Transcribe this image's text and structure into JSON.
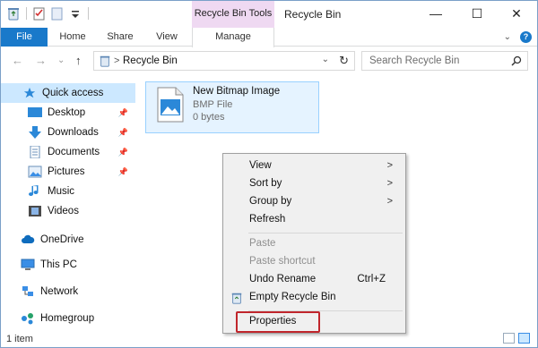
{
  "window": {
    "title": "Recycle Bin",
    "contextual_tab_group": "Recycle Bin Tools",
    "controls": {
      "minimize": "—",
      "maximize": "☐",
      "close": "✕"
    }
  },
  "ribbon": {
    "tabs": {
      "file": "File",
      "home": "Home",
      "share": "Share",
      "view": "View",
      "manage": "Manage"
    },
    "collapse_glyph": "⌄",
    "help_glyph": "?",
    "accent": "#1979ca"
  },
  "address_bar": {
    "back": "←",
    "forward": "→",
    "recent": "⌄",
    "up": "↑",
    "chevron": ">",
    "location": "Recycle Bin",
    "dropdown": "⌄",
    "refresh": "↻"
  },
  "search": {
    "placeholder": "Search Recycle Bin",
    "icon": "search-icon"
  },
  "nav_pane": {
    "items": [
      {
        "label": "Quick access",
        "icon": "star-icon",
        "selected": true
      },
      {
        "label": "Desktop",
        "icon": "desktop-icon",
        "pinned": true
      },
      {
        "label": "Downloads",
        "icon": "download-icon",
        "pinned": true
      },
      {
        "label": "Documents",
        "icon": "documents-icon",
        "pinned": true
      },
      {
        "label": "Pictures",
        "icon": "pictures-icon",
        "pinned": true
      },
      {
        "label": "Music",
        "icon": "music-icon"
      },
      {
        "label": "Videos",
        "icon": "videos-icon"
      },
      {
        "label": "OneDrive",
        "icon": "cloud-icon"
      },
      {
        "label": "This PC",
        "icon": "computer-icon"
      },
      {
        "label": "Network",
        "icon": "network-icon"
      },
      {
        "label": "Homegroup",
        "icon": "homegroup-icon"
      }
    ]
  },
  "file": {
    "name": "New Bitmap Image",
    "type": "BMP File",
    "size": "0 bytes",
    "icon": "bitmap-file-icon"
  },
  "context_menu": {
    "items": {
      "view": "View",
      "sort_by": "Sort by",
      "group_by": "Group by",
      "refresh": "Refresh",
      "paste": "Paste",
      "paste_shortcut": "Paste shortcut",
      "undo_rename": "Undo Rename",
      "undo_shortcut": "Ctrl+Z",
      "empty_recycle_bin": "Empty Recycle Bin",
      "properties": "Properties"
    },
    "submenu_arrow": ">",
    "highlight_color": "#c0262c"
  },
  "status_bar": {
    "item_count": "1 item"
  }
}
